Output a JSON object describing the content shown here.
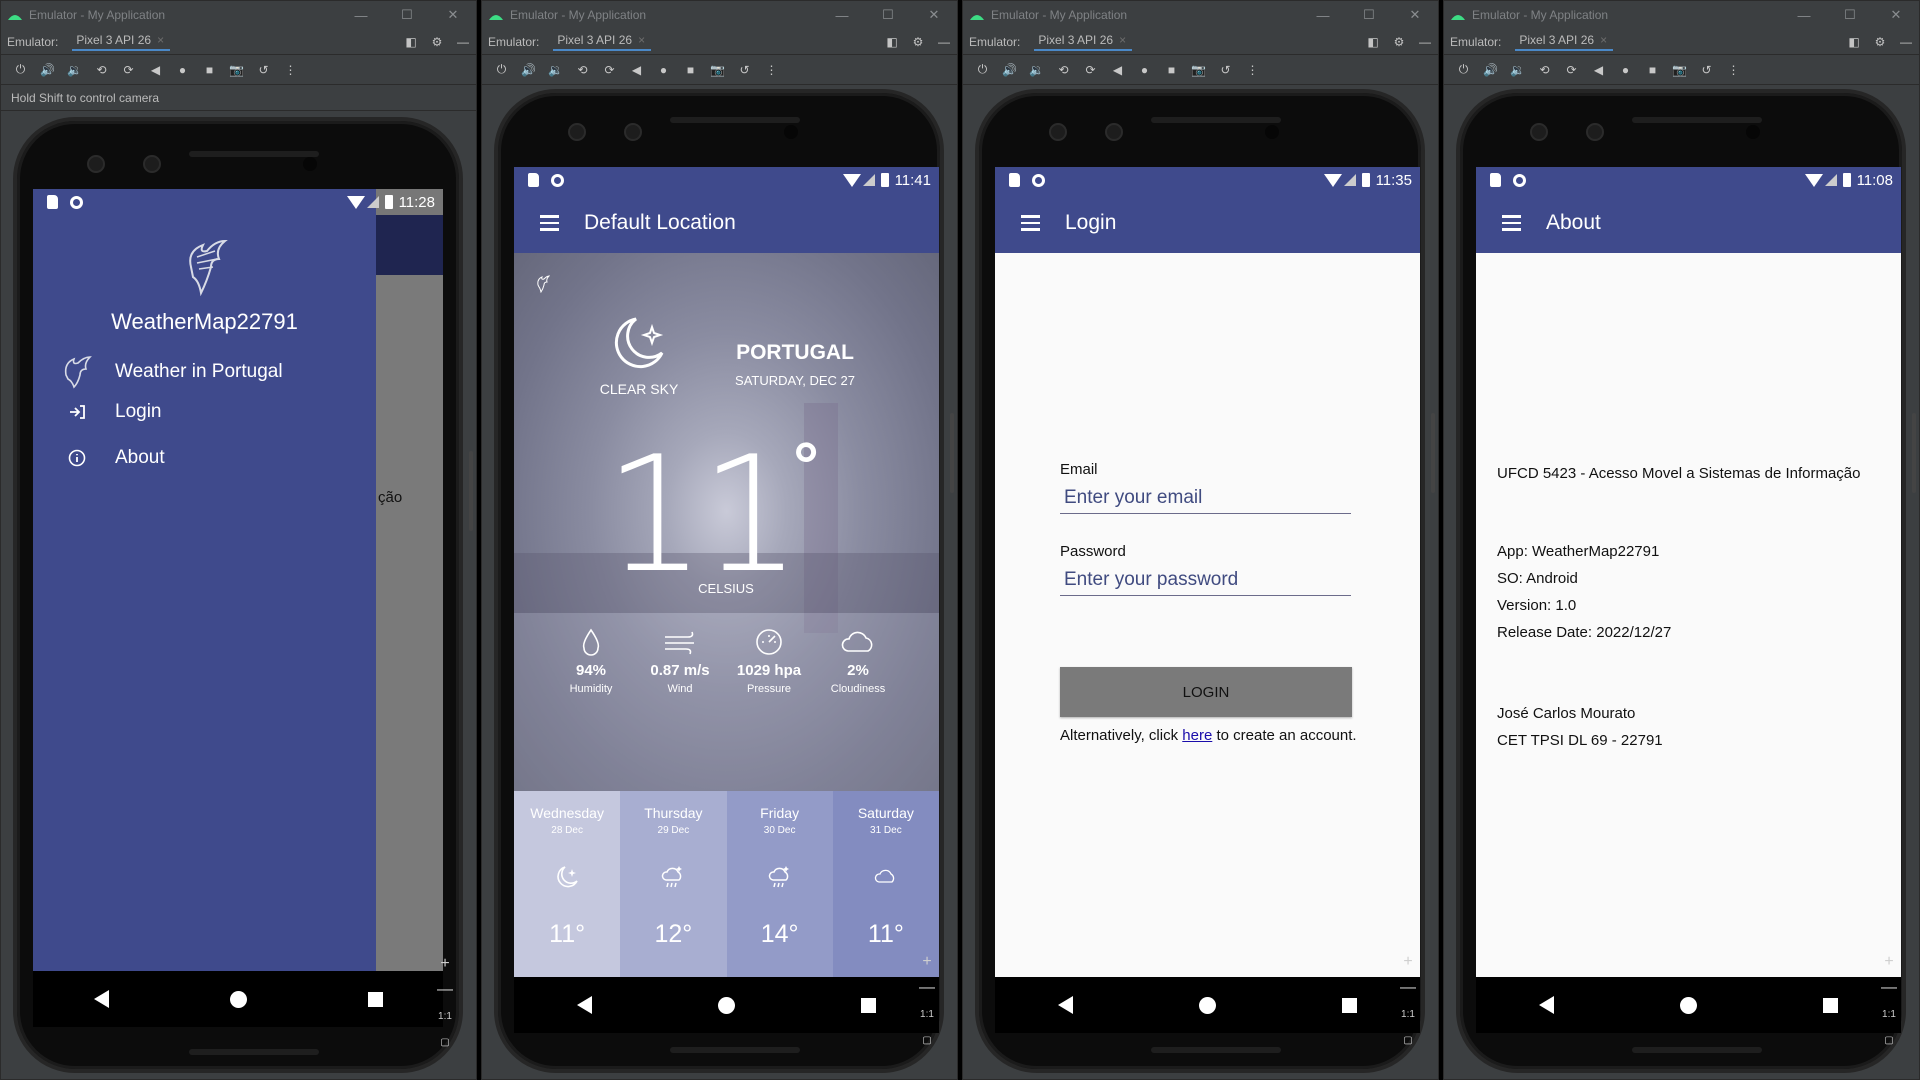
{
  "window": {
    "title": "Emulator - My Application",
    "minimize": "—",
    "maximize": "☐",
    "close": "✕",
    "emulator_label": "Emulator:",
    "device_tab": "Pixel 3 API 26",
    "tab_close": "×"
  },
  "hint": "Hold Shift to control camera",
  "zoom": {
    "plus": "+",
    "minus": "—",
    "ratio": "1:1"
  },
  "drawer_screen": {
    "time": "11:28",
    "app_name": "WeatherMap22791",
    "items": [
      {
        "label": "Weather in Portugal",
        "icon": "eagle-icon"
      },
      {
        "label": "Login",
        "icon": "login-icon"
      },
      {
        "label": "About",
        "icon": "info-icon"
      }
    ],
    "peek_text": "ção"
  },
  "weather_screen": {
    "time": "11:41",
    "title": "Default Location",
    "condition": "CLEAR SKY",
    "country": "PORTUGAL",
    "date": "SATURDAY, DEC 27",
    "temperature": "11",
    "degree": "°",
    "unit": "CELSIUS",
    "stats": [
      {
        "value": "94%",
        "label": "Humidity",
        "icon": "droplet-icon"
      },
      {
        "value": "0.87 m/s",
        "label": "Wind",
        "icon": "wind-icon"
      },
      {
        "value": "1029 hpa",
        "label": "Pressure",
        "icon": "gauge-icon"
      },
      {
        "value": "2%",
        "label": "Cloudiness",
        "icon": "cloud-icon"
      }
    ],
    "forecast": [
      {
        "day": "Wednesday",
        "date": "28 Dec",
        "temp": "11°",
        "icon": "moon-star-icon",
        "bg": "#c5c8de"
      },
      {
        "day": "Thursday",
        "date": "29 Dec",
        "temp": "12°",
        "icon": "cloud-moon-rain-icon",
        "bg": "#a8aed1"
      },
      {
        "day": "Friday",
        "date": "30 Dec",
        "temp": "14°",
        "icon": "cloud-moon-rain-icon",
        "bg": "#939bc8"
      },
      {
        "day": "Saturday",
        "date": "31 Dec",
        "temp": "11°",
        "icon": "cloud-icon",
        "bg": "#838cc0"
      }
    ]
  },
  "login_screen": {
    "time": "11:35",
    "title": "Login",
    "email_label": "Email",
    "email_placeholder": "Enter your email",
    "password_label": "Password",
    "password_placeholder": "Enter your password",
    "button": "LOGIN",
    "alt_before": "Alternatively, click ",
    "alt_link": "here",
    "alt_after": " to create an account."
  },
  "about_screen": {
    "time": "11:08",
    "title": "About",
    "course": "UFCD 5423 - Acesso Movel a Sistemas de Informação",
    "app": "App: WeatherMap22791",
    "os": "SO: Android",
    "version": "Version: 1.0",
    "release": "Release Date: 2022/12/27",
    "author": "José Carlos Mourato",
    "class": "CET TPSI DL 69 - 22791"
  },
  "colors": {
    "primary": "#3f4a8c",
    "ide_bg": "#3c3f41"
  }
}
